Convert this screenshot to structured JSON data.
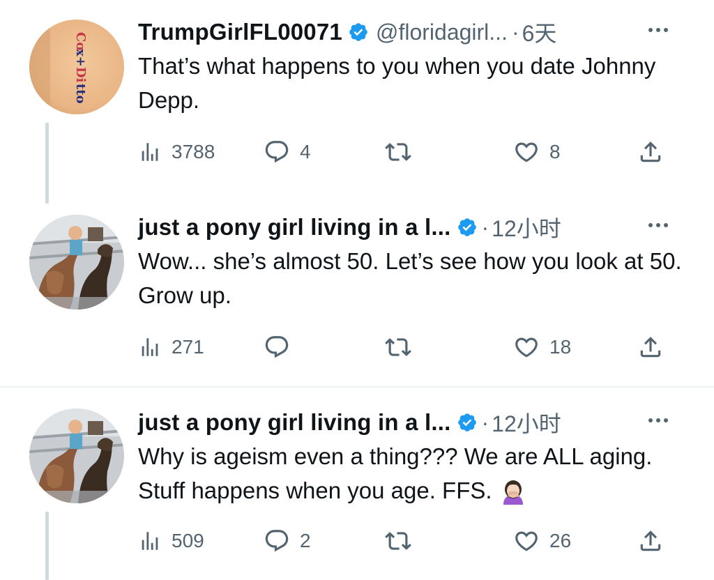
{
  "tweets": [
    {
      "display_name": "TrumpGirlFL00071",
      "handle": "@floridagirl...",
      "dot": "·",
      "time": "6天",
      "text": "That’s what happens to you when you date Johnny Depp.",
      "views": "3788",
      "replies": "4",
      "retweets": "",
      "likes": "8"
    },
    {
      "display_name": "just a pony girl living in a l...",
      "dot": "·",
      "time": "12小时",
      "text": "Wow... she’s almost 50. Let’s see how you look at 50. Grow up.",
      "views": "271",
      "replies": "",
      "retweets": "",
      "likes": "18"
    },
    {
      "display_name": "just a pony girl living in a l...",
      "dot": "·",
      "time": "12小时",
      "text": "Why is ageism even a thing??? We are ALL aging. Stuff happens when you age. FFS.",
      "views": "509",
      "replies": "2",
      "retweets": "",
      "likes": "26"
    }
  ],
  "avatar_1_tattoo_text": "Cox+Ditto",
  "emoji_name": "woman-facepalming",
  "colors": {
    "verified": "#1d9bf0",
    "muted": "#536471",
    "text": "#0f1419",
    "thread_line": "#cfd9de"
  },
  "icons": [
    "views-icon",
    "reply-icon",
    "retweet-icon",
    "like-icon",
    "share-icon",
    "more-icon",
    "verified-badge-icon"
  ]
}
